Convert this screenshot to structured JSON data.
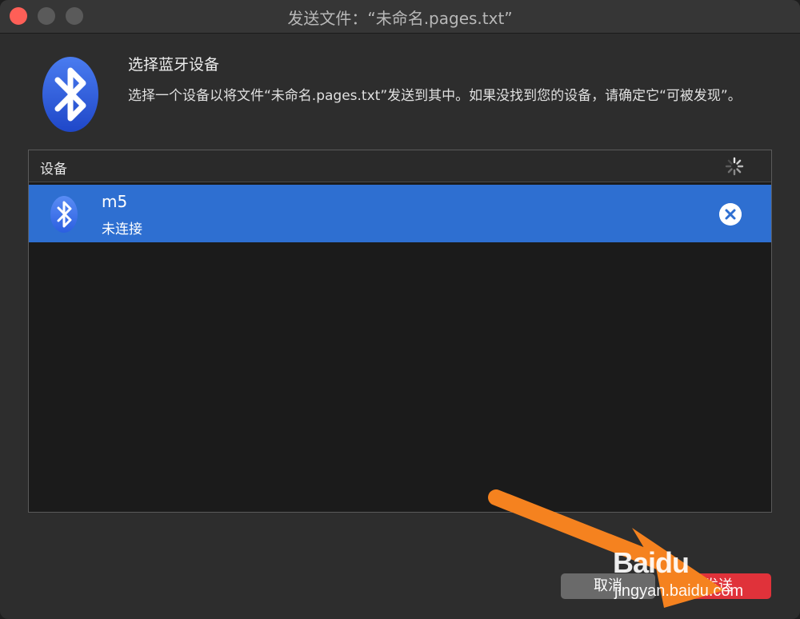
{
  "window": {
    "title": "发送文件：“未命名.pages.txt”"
  },
  "header": {
    "heading": "选择蓝牙设备",
    "description": "选择一个设备以将文件“未命名.pages.txt”发送到其中。如果没找到您的设备，请确定它“可被发现”。"
  },
  "device_list": {
    "column_header": "设备",
    "searching": true,
    "items": [
      {
        "name": "m5",
        "status": "未连接",
        "selected": true,
        "icon": "bluetooth-icon"
      }
    ]
  },
  "buttons": {
    "cancel_label": "取消",
    "send_label": "发送"
  },
  "watermark": {
    "logo": "Baidu",
    "url": "jingyan.baidu.com"
  },
  "colors": {
    "selection": "#2e6fd1",
    "bluetooth_blue": "#2b5fe0",
    "send_button": "#e0323a",
    "arrow": "#f5821f"
  }
}
